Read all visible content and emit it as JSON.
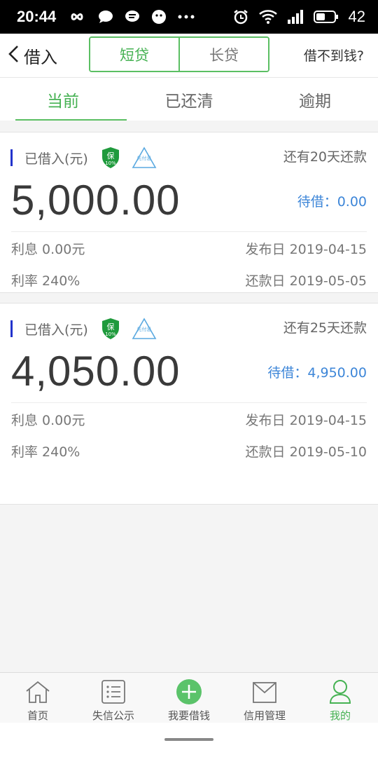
{
  "status_bar": {
    "time": "20:44",
    "battery": "42",
    "icons_left": [
      "infinity-icon",
      "chat-bubble-icon",
      "message-icon",
      "smiley-icon",
      "more-icon"
    ],
    "icons_right": [
      "alarm-icon",
      "wifi-icon",
      "signal-icon",
      "battery-icon"
    ]
  },
  "header": {
    "back_label": "借入",
    "segments": [
      "短贷",
      "长贷"
    ],
    "active_segment": 0,
    "right_link": "借不到钱?"
  },
  "tabs": [
    {
      "label": "当前",
      "active": true
    },
    {
      "label": "已还清",
      "active": false
    },
    {
      "label": "逾期",
      "active": false
    }
  ],
  "loans": [
    {
      "label": "已借入(元)",
      "badge_guarantee": "保",
      "badge_guarantee_pct": "10%",
      "badge_prepay": "先付息",
      "due_text": "还有20天还款",
      "amount": "5,000.00",
      "pending": "待借：0.00",
      "interest": "利息 0.00元",
      "publish_date": "发布日 2019-04-15",
      "rate": "利率 240%",
      "repay_date": "还款日 2019-05-05"
    },
    {
      "label": "已借入(元)",
      "badge_guarantee": "保",
      "badge_guarantee_pct": "10%",
      "badge_prepay": "先付息",
      "due_text": "还有25天还款",
      "amount": "4,050.00",
      "pending": "待借：4,950.00",
      "interest": "利息 0.00元",
      "publish_date": "发布日 2019-04-15",
      "rate": "利率 240%",
      "repay_date": "还款日 2019-05-10"
    }
  ],
  "tabbar": [
    {
      "label": "首页",
      "icon": "home-icon",
      "active": false
    },
    {
      "label": "失信公示",
      "icon": "list-icon",
      "active": false
    },
    {
      "label": "我要借钱",
      "icon": "plus-circle-icon",
      "active": false
    },
    {
      "label": "信用管理",
      "icon": "inbox-icon",
      "active": false
    },
    {
      "label": "我的",
      "icon": "person-icon",
      "active": true
    }
  ],
  "colors": {
    "accent_green": "#46b253",
    "link_blue": "#3d86d8",
    "marker_blue": "#2233cc"
  }
}
